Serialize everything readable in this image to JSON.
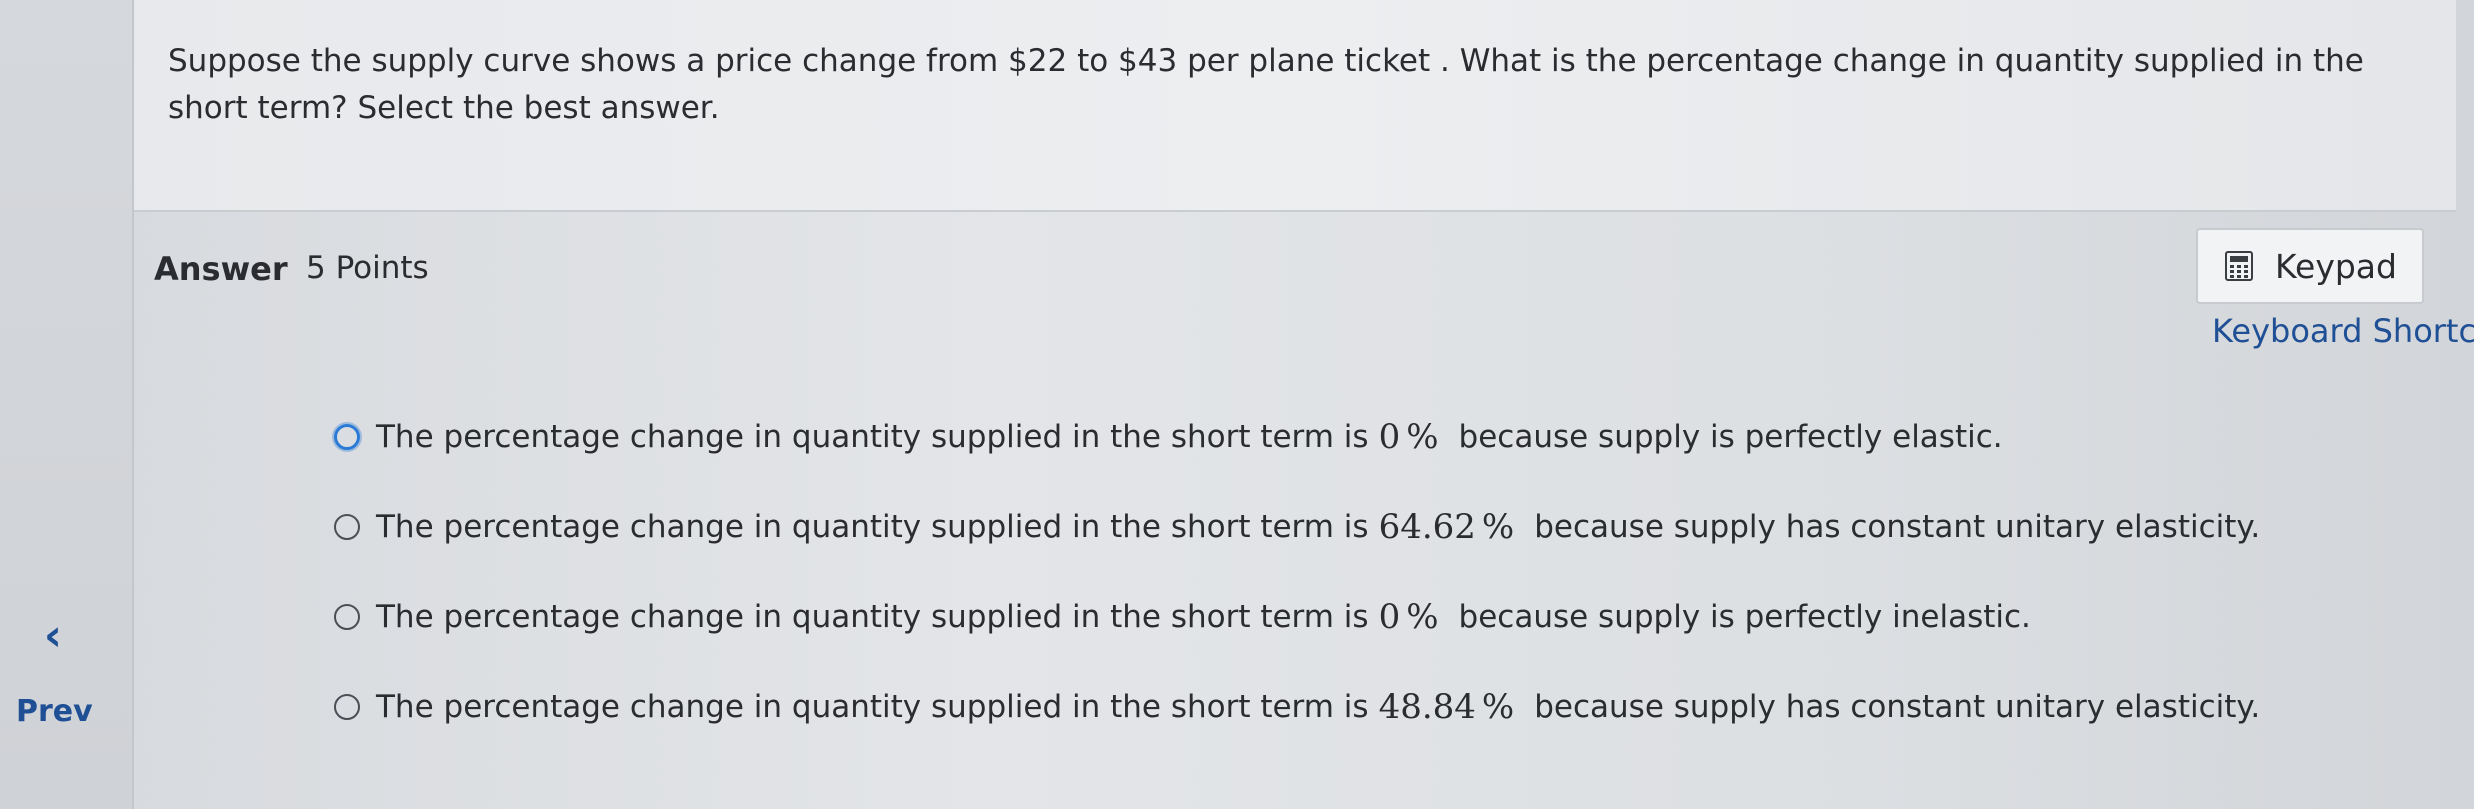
{
  "nav": {
    "prev_label": "Prev",
    "prev_icon": "chevron-left-icon"
  },
  "question": {
    "text": "Suppose the supply curve shows a price change from $22 to $43 per plane ticket . What is the percentage change in quantity supplied in the short term? Select the best answer."
  },
  "answer": {
    "label": "Answer",
    "points": "5 Points"
  },
  "tools": {
    "keypad_label": "Keypad",
    "keypad_icon": "calculator-icon",
    "shortcuts_label": "Keyboard Shortcuts"
  },
  "options": [
    {
      "prefix": "The percentage change in quantity supplied in the short term is",
      "value": "0",
      "unit": "%",
      "suffix": "because supply is perfectly elastic.",
      "selected": false,
      "focused": true
    },
    {
      "prefix": "The percentage change in quantity supplied in the short term is",
      "value": "64.62",
      "unit": "%",
      "suffix": "because supply has constant unitary elasticity.",
      "selected": false,
      "focused": false
    },
    {
      "prefix": "The percentage change in quantity supplied in the short term is",
      "value": "0",
      "unit": "%",
      "suffix": "because supply is perfectly inelastic.",
      "selected": false,
      "focused": false
    },
    {
      "prefix": "The percentage change in quantity supplied in the short term is",
      "value": "48.84",
      "unit": "%",
      "suffix": "because supply has constant unitary elasticity.",
      "selected": false,
      "focused": false
    }
  ],
  "colors": {
    "link": "#1f4f94",
    "focus_ring": "#2a7ad6",
    "text": "#2a2c30"
  }
}
